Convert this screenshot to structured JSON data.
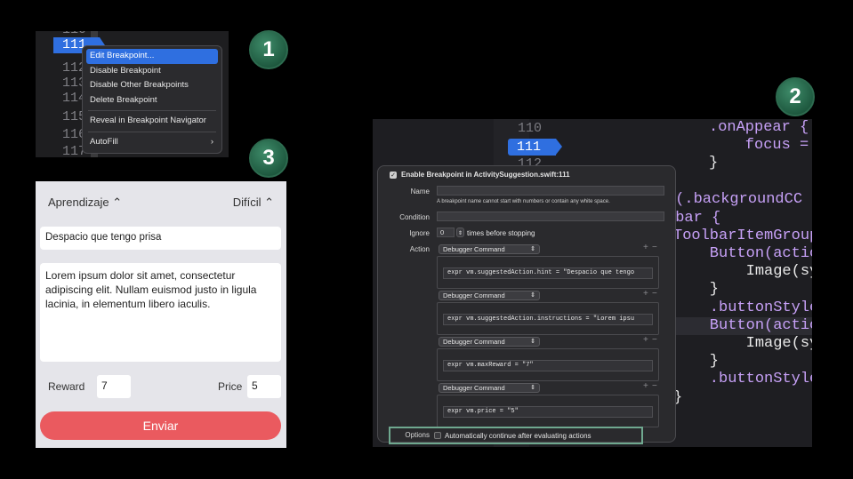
{
  "badges": [
    "1",
    "2",
    "3"
  ],
  "panel1": {
    "line_numbers": [
      "110",
      "111",
      "112",
      "113",
      "114",
      "115",
      "116",
      "117"
    ],
    "breakpoint_line": "111",
    "menu": {
      "items": [
        "Edit Breakpoint...",
        "Disable Breakpoint",
        "Disable Other Breakpoints",
        "Delete Breakpoint",
        "Reveal in Breakpoint Navigator",
        "AutoFill"
      ],
      "selected": "Edit Breakpoint...",
      "submenu_indicator": "›"
    }
  },
  "panel2": {
    "line_numbers": [
      "110",
      "111",
      "112"
    ],
    "breakpoint_line": "111",
    "code_lines": [
      ".onAppear {",
      "    focus =",
      "}",
      "t(.backgroundCC",
      "lbar {",
      "ToolbarItemGroup",
      "    Button(actio",
      "        Image(sy",
      "    }",
      "    .buttonStyle",
      "    Button(actio",
      "        Image(sy",
      "    }",
      "    .buttonStyle",
      "}"
    ],
    "popover": {
      "title": "Enable Breakpoint in ActivitySuggestion.swift:111",
      "name_label": "Name",
      "name_value": "",
      "name_hint": "A breakpoint name cannot start with numbers or contain any white space.",
      "condition_label": "Condition",
      "condition_value": "",
      "ignore_label": "Ignore",
      "ignore_value": "0",
      "ignore_suffix": "times before stopping",
      "action_label": "Action",
      "actions": [
        {
          "type": "Debugger Command",
          "expr": "expr vm.suggestedAction.hint = \"Despacio que tengo"
        },
        {
          "type": "Debugger Command",
          "expr": "expr vm.suggestedAction.instructions  = \"Lorem ipsu"
        },
        {
          "type": "Debugger Command",
          "expr": "expr vm.maxReward = \"7\""
        },
        {
          "type": "Debugger Command",
          "expr": "expr vm.price = \"5\""
        }
      ],
      "plus": "+",
      "minus": "−",
      "options_label": "Options",
      "options_checkbox": "Automatically continue after evaluating actions",
      "enabled_check": "✓",
      "highlight_color": "#6fa88f"
    }
  },
  "panel3": {
    "left_picker": "Aprendizaje ⌃",
    "right_picker": "Difícil ⌃",
    "hint_field": "Despacio que tengo prisa",
    "instructions": "Lorem ipsum dolor sit amet, consectetur adipiscing elit. Nullam euismod justo in ligula lacinia, in elementum libero iaculis.",
    "reward_label": "Reward",
    "reward_value": "7",
    "price_label": "Price",
    "price_value": "5",
    "send_label": "Enviar",
    "send_color": "#ea5a5f"
  }
}
